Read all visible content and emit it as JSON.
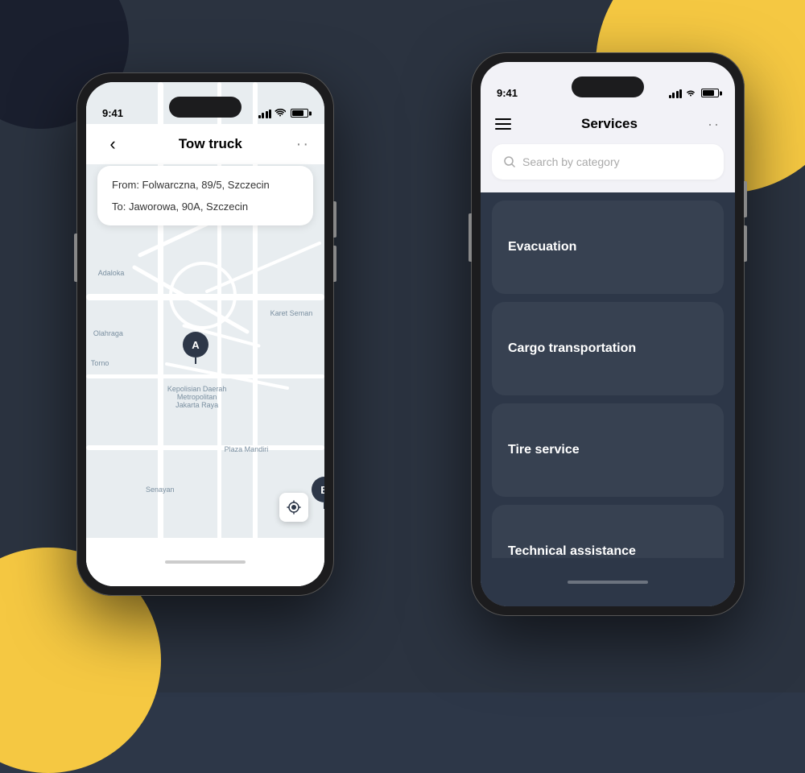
{
  "background": {
    "main_color": "#2b3340",
    "accent_color": "#f5c842"
  },
  "phone_left": {
    "status_time": "9:41",
    "title": "Tow truck",
    "back_label": "<",
    "more_label": "...",
    "address_from": "From: Folwarczna, 89/5, Szczecin",
    "address_to": "To: Jaworowa, 90A, Szczecin",
    "map_labels": [
      "Adaloka",
      "Olahraga",
      "Torno",
      "Kepolisian Daerah Metropolitan Jakarta Raya",
      "Karet Seman",
      "Plaza Mandiri",
      "Senayan"
    ],
    "marker_a": "A",
    "marker_b": "B"
  },
  "phone_right": {
    "status_time": "9:41",
    "title": "Services",
    "menu_label": "menu",
    "more_label": "...",
    "search_placeholder": "Search by category",
    "services": [
      {
        "id": "evacuation",
        "label": "Evacuation"
      },
      {
        "id": "cargo",
        "label": "Cargo transportation"
      },
      {
        "id": "tire",
        "label": "Tire service"
      },
      {
        "id": "technical",
        "label": "Technical assistance"
      }
    ]
  }
}
